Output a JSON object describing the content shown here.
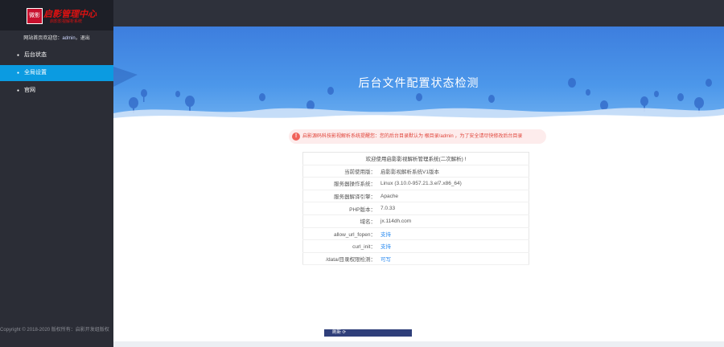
{
  "logo": {
    "badge": "微影",
    "title": "启影管理中心",
    "subtitle": "启影影视解析系统"
  },
  "userbar": {
    "home": "网站首页",
    "greeting": "欢迎您：",
    "username": "admin",
    "logout": "退出"
  },
  "nav": [
    {
      "label": "后台状态",
      "active": false
    },
    {
      "label": "全局设置",
      "active": true
    },
    {
      "label": "官网",
      "active": false
    }
  ],
  "copyright": "Copyright © 2018-2020 版权所有：启影开发组版权",
  "hero": {
    "title": "后台文件配置状态检测"
  },
  "warning": {
    "icon": "!",
    "text": "启影源码科技影视解析系统提醒您：您的后台目录默认为 根目录/admin ，为了安全请尽快修改后台目录"
  },
  "info": {
    "heading": "欢迎使用启影影视解析管理系统(二次解析) !",
    "rows": [
      {
        "key": "当前使用版：",
        "value": "启影影视解析系统V1版本",
        "ok": false
      },
      {
        "key": "服务器操作系统：",
        "value": "Linux (3.10.0-957.21.3.el7.x86_64)",
        "ok": false
      },
      {
        "key": "服务器解译引擎：",
        "value": "Apache",
        "ok": false
      },
      {
        "key": "PHP版本：",
        "value": "7.0.33",
        "ok": false
      },
      {
        "key": "域名：",
        "value": "jx.114dh.com",
        "ok": false
      },
      {
        "key": "allow_url_fopen：",
        "value": "支持",
        "ok": true
      },
      {
        "key": "curl_init：",
        "value": "支持",
        "ok": true
      },
      {
        "key": "/data/目录权限检测：",
        "value": "可写",
        "ok": true
      }
    ]
  },
  "bottom": {
    "label": "刷新 ⟳"
  },
  "colors": {
    "sidebar": "#2b2d36",
    "active": "#0b9be1",
    "hero": "#4c97ea",
    "warn": "#e0443a",
    "ok": "#2d8cf0"
  }
}
